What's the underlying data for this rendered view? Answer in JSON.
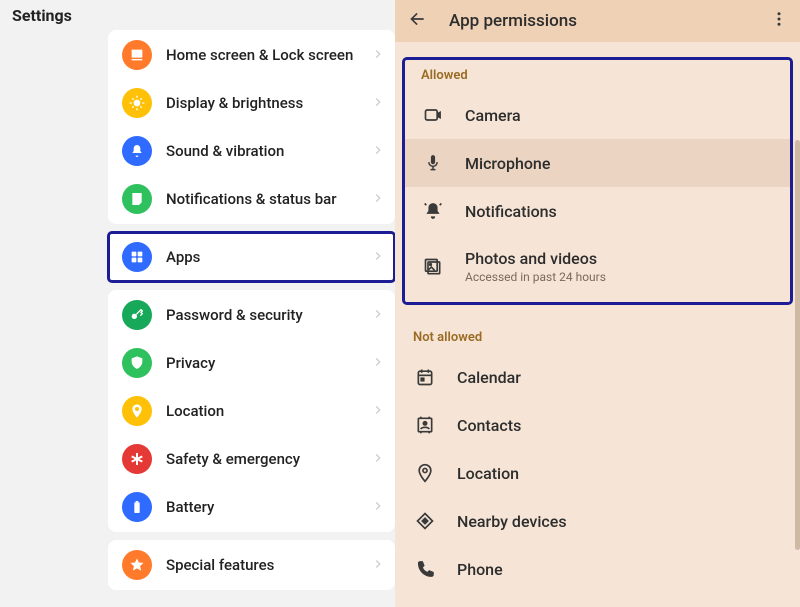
{
  "settings": {
    "title": "Settings",
    "groups": [
      {
        "card": true,
        "items": [
          {
            "key": "home",
            "label": "Home screen & Lock screen",
            "icon": "home-icon",
            "bg": "bg-orange"
          },
          {
            "key": "display",
            "label": "Display & brightness",
            "icon": "sun-icon",
            "bg": "bg-yellow"
          },
          {
            "key": "sound",
            "label": "Sound & vibration",
            "icon": "bell-icon",
            "bg": "bg-blue"
          },
          {
            "key": "notif",
            "label": "Notifications & status bar",
            "icon": "note-icon",
            "bg": "bg-green"
          }
        ]
      },
      {
        "card": true,
        "highlight": true,
        "items": [
          {
            "key": "apps",
            "label": "Apps",
            "icon": "grid-icon",
            "bg": "bg-blue"
          }
        ]
      },
      {
        "card": true,
        "items": [
          {
            "key": "pwd",
            "label": "Password & security",
            "icon": "key-icon",
            "bg": "bg-green2"
          },
          {
            "key": "privacy",
            "label": "Privacy",
            "icon": "shield-icon",
            "bg": "bg-green"
          },
          {
            "key": "location",
            "label": "Location",
            "icon": "pin-icon",
            "bg": "bg-yellow"
          },
          {
            "key": "safety",
            "label": "Safety & emergency",
            "icon": "asterisk-icon",
            "bg": "bg-red"
          },
          {
            "key": "battery",
            "label": "Battery",
            "icon": "battery-icon",
            "bg": "bg-blue"
          }
        ]
      },
      {
        "card": true,
        "items": [
          {
            "key": "special",
            "label": "Special features",
            "icon": "star-icon",
            "bg": "bg-orange"
          }
        ]
      }
    ]
  },
  "permissions": {
    "title": "App permissions",
    "allowed_header": "Allowed",
    "not_allowed_header": "Not allowed",
    "allowed": [
      {
        "key": "camera",
        "label": "Camera",
        "icon": "camera-icon"
      },
      {
        "key": "microphone",
        "label": "Microphone",
        "icon": "mic-icon",
        "hover": true
      },
      {
        "key": "notifs",
        "label": "Notifications",
        "icon": "bell2-icon"
      },
      {
        "key": "photos",
        "label": "Photos and videos",
        "icon": "photos-icon",
        "sub": "Accessed in past 24 hours"
      }
    ],
    "not_allowed": [
      {
        "key": "calendar",
        "label": "Calendar",
        "icon": "calendar-icon"
      },
      {
        "key": "contacts",
        "label": "Contacts",
        "icon": "contacts-icon"
      },
      {
        "key": "location",
        "label": "Location",
        "icon": "pin2-icon"
      },
      {
        "key": "nearby",
        "label": "Nearby devices",
        "icon": "diamond-icon"
      },
      {
        "key": "phone",
        "label": "Phone",
        "icon": "phone-icon"
      }
    ]
  }
}
